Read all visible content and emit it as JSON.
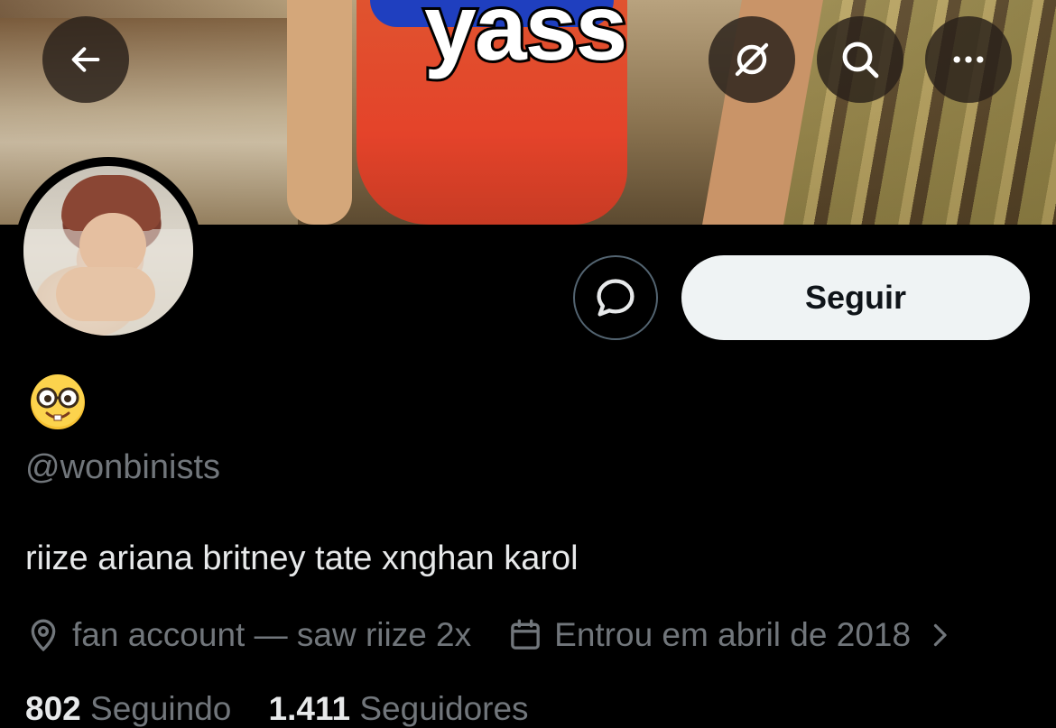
{
  "banner": {
    "caption": "yass"
  },
  "top_bar": {
    "back_icon": "arrow-left-icon",
    "grok_icon": "grok-icon",
    "search_icon": "search-icon",
    "more_icon": "more-horizontal-icon"
  },
  "profile": {
    "display_name_emoji": "nerd-face-emoji",
    "handle": "@wonbinists",
    "bio": "riize ariana britney tate xnghan karol",
    "location": "fan account — saw riize 2x",
    "joined": "Entrou em abril de 2018"
  },
  "actions": {
    "message_icon": "message-bubble-icon",
    "follow_label": "Seguir"
  },
  "stats": {
    "following_count": "802",
    "following_label": "Seguindo",
    "followers_count": "1.411",
    "followers_label": "Seguidores"
  },
  "colors": {
    "background": "#000000",
    "primary_text": "#e7e9ea",
    "secondary_text": "#71767b",
    "follow_button_bg": "#eff3f4",
    "border": "#536471"
  }
}
